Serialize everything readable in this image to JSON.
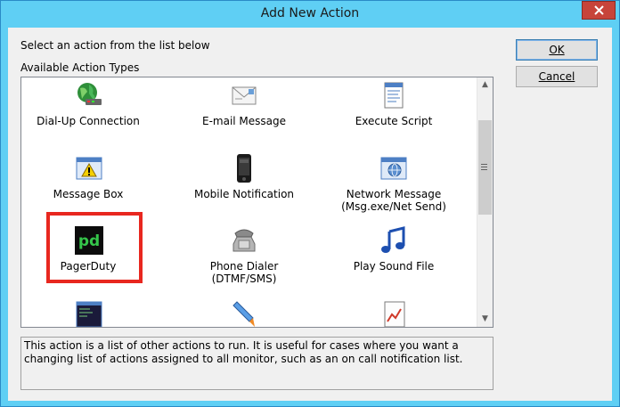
{
  "window": {
    "title": "Add New Action"
  },
  "prompt": "Select an action from the list below",
  "list_label": "Available Action Types",
  "buttons": {
    "ok": "OK",
    "cancel": "Cancel"
  },
  "actions": [
    {
      "label": "Dial-Up Connection",
      "icon": "globe-modem-icon"
    },
    {
      "label": "E-mail Message",
      "icon": "envelope-icon"
    },
    {
      "label": "Execute Script",
      "icon": "script-document-icon"
    },
    {
      "label": "Message Box",
      "icon": "warning-dialog-icon"
    },
    {
      "label": "Mobile Notification",
      "icon": "mobile-phone-icon"
    },
    {
      "label": "Network Message\n(Msg.exe/Net Send)",
      "label_line1": "Network Message",
      "label_line2": "(Msg.exe/Net Send)",
      "icon": "network-window-icon"
    },
    {
      "label": "PagerDuty",
      "icon": "pagerduty-logo-icon"
    },
    {
      "label": "Phone Dialer (DTMF/SMS)",
      "icon": "telephone-icon"
    },
    {
      "label": "Play Sound File",
      "icon": "music-note-icon"
    },
    {
      "label": "",
      "icon": "terminal-window-icon"
    },
    {
      "label": "",
      "icon": "rocket-icon"
    },
    {
      "label": "",
      "icon": "chart-document-icon"
    }
  ],
  "description": "This action is a list of other actions to run.  It is useful for cases where you want a changing list of actions assigned to all monitor, such as an on call notification list.",
  "colors": {
    "titlebar": "#5fcff4",
    "close": "#c7443a",
    "highlight": "#e8271f"
  }
}
